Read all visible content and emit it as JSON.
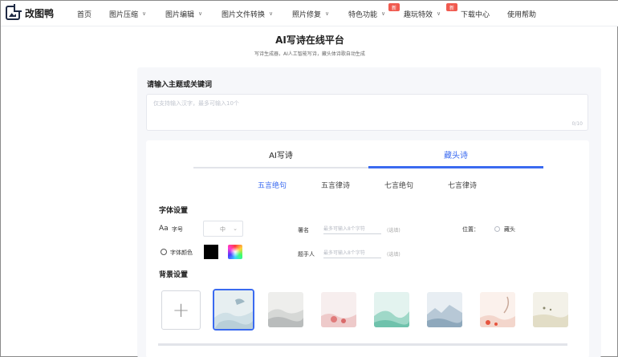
{
  "app": {
    "name": "改图鸭"
  },
  "nav": {
    "items": [
      {
        "label": "首页"
      },
      {
        "label": "图片压缩",
        "chevron": true
      },
      {
        "label": "图片编辑",
        "chevron": true
      },
      {
        "label": "图片文件转换",
        "chevron": true
      },
      {
        "label": "照片修复",
        "chevron": true
      },
      {
        "label": "特色功能",
        "chevron": true,
        "badge": "新"
      },
      {
        "label": "趣玩特效",
        "chevron": true,
        "badge": "新"
      },
      {
        "label": "下载中心"
      },
      {
        "label": "使用帮助"
      }
    ]
  },
  "page": {
    "title": "AI写诗在线平台",
    "subtitle": "写诗生成器，AI人工智能写诗，藏头体诗歌自动生成"
  },
  "keyword": {
    "label": "请输入主题或关键词",
    "placeholder": "仅支持输入汉字，最多可输入10个",
    "count": "0/10"
  },
  "main_tabs": [
    {
      "label": "AI写诗",
      "active": false
    },
    {
      "label": "藏头诗",
      "active": true
    }
  ],
  "sub_tabs": [
    {
      "label": "五言绝句",
      "active": true
    },
    {
      "label": "五言律诗",
      "active": false
    },
    {
      "label": "七言绝句",
      "active": false
    },
    {
      "label": "七言律诗",
      "active": false
    }
  ],
  "font_settings": {
    "title": "字体设置",
    "size_icon": "Aa",
    "size_label": "字号",
    "size_value": "中",
    "color_label": "字体颜色",
    "signature_label": "署名",
    "signature_placeholder": "最多可输入8个字符",
    "signature_hint": "(选填)",
    "author_label": "题手人",
    "author_placeholder": "最多可输入8个字符",
    "author_hint": "(选填)",
    "position_label": "位置：",
    "position_option": "藏头"
  },
  "background_settings": {
    "title": "背景设置"
  },
  "colors": {
    "accent": "#3a6af0",
    "badge": "#f05a4f"
  }
}
